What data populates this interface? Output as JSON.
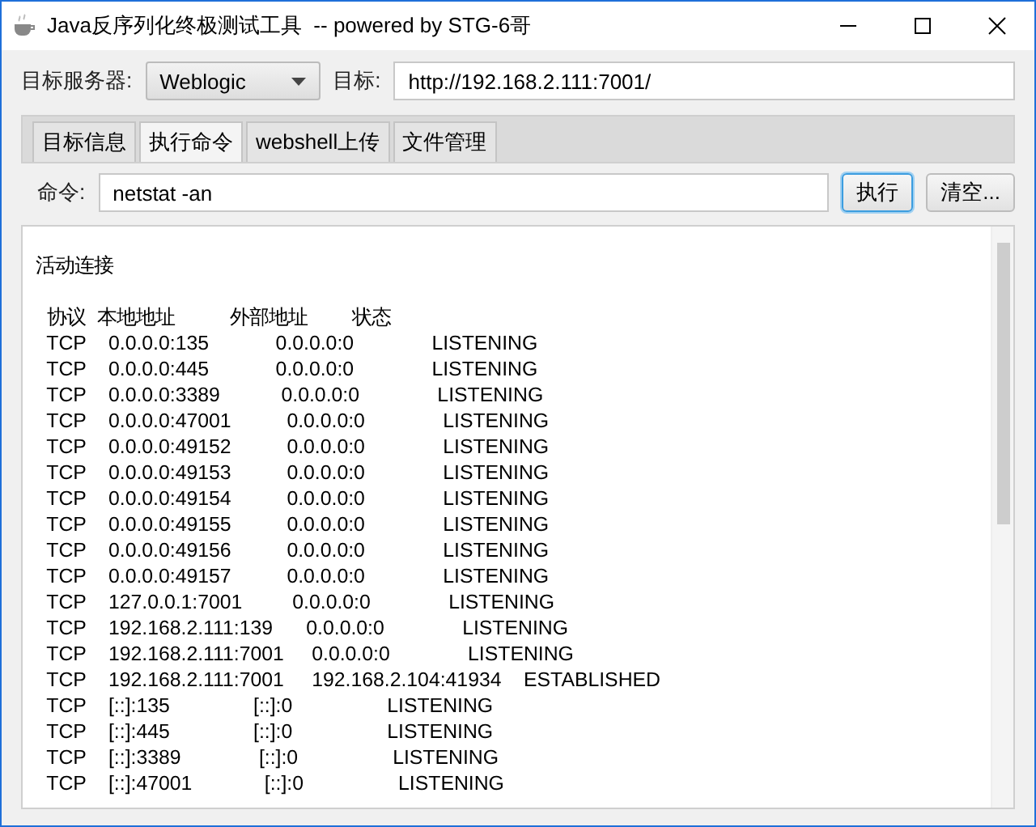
{
  "window": {
    "title": "Java反序列化终极测试工具  -- powered by STG-6哥"
  },
  "server": {
    "label": "目标服务器:",
    "value": "Weblogic"
  },
  "target": {
    "label": "目标:",
    "value": "http://192.168.2.111:7001/"
  },
  "tabs": [
    {
      "label": "目标信息",
      "selected": false
    },
    {
      "label": "执行命令",
      "selected": true
    },
    {
      "label": "webshell上传",
      "selected": false
    },
    {
      "label": "文件管理",
      "selected": false
    }
  ],
  "command": {
    "label": "命令:",
    "value": "netstat -an"
  },
  "buttons": [
    {
      "label": "执行",
      "focused": true
    },
    {
      "label": "清空...",
      "focused": false
    }
  ],
  "output": {
    "heading": "活动连接",
    "lines": [
      "  协议  本地地址          外部地址        状态",
      "  TCP    0.0.0.0:135            0.0.0.0:0              LISTENING",
      "  TCP    0.0.0.0:445            0.0.0.0:0              LISTENING",
      "  TCP    0.0.0.0:3389           0.0.0.0:0              LISTENING",
      "  TCP    0.0.0.0:47001          0.0.0.0:0              LISTENING",
      "  TCP    0.0.0.0:49152          0.0.0.0:0              LISTENING",
      "  TCP    0.0.0.0:49153          0.0.0.0:0              LISTENING",
      "  TCP    0.0.0.0:49154          0.0.0.0:0              LISTENING",
      "  TCP    0.0.0.0:49155          0.0.0.0:0              LISTENING",
      "  TCP    0.0.0.0:49156          0.0.0.0:0              LISTENING",
      "  TCP    0.0.0.0:49157          0.0.0.0:0              LISTENING",
      "  TCP    127.0.0.1:7001         0.0.0.0:0              LISTENING",
      "  TCP    192.168.2.111:139      0.0.0.0:0              LISTENING",
      "  TCP    192.168.2.111:7001     0.0.0.0:0              LISTENING",
      "  TCP    192.168.2.111:7001     192.168.2.104:41934    ESTABLISHED",
      "  TCP    [::]:135               [::]:0                 LISTENING",
      "  TCP    [::]:445               [::]:0                 LISTENING",
      "  TCP    [::]:3389              [::]:0                 LISTENING",
      "  TCP    [::]:47001             [::]:0                 LISTENING"
    ]
  }
}
